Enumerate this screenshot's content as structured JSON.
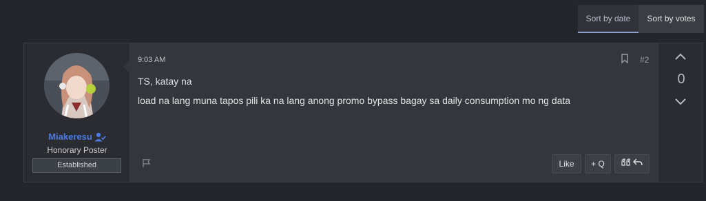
{
  "sort": {
    "by_date_label": "Sort by date",
    "by_votes_label": "Sort by votes"
  },
  "post": {
    "author": {
      "username": "Miakeresu",
      "title": "Honorary Poster",
      "badge": "Established",
      "username_color": "#4c7be0",
      "verified_icon": "user-check-icon"
    },
    "timestamp": "9:03 AM",
    "post_number": "#2",
    "lines": [
      "TS, katay na",
      "load na lang muna tapos pili ka na lang anong promo bypass bagay sa daily consumption mo ng data"
    ],
    "actions": {
      "like_label": "Like",
      "multiquote_label": "+ Q",
      "quote_reply_icons": [
        "quote-icon",
        "reply-icon"
      ],
      "report_icon": "flag-icon",
      "bookmark_icon": "bookmark-icon"
    },
    "votes": {
      "count": "0",
      "up_icon": "chevron-up-icon",
      "down_icon": "chevron-down-icon"
    }
  }
}
